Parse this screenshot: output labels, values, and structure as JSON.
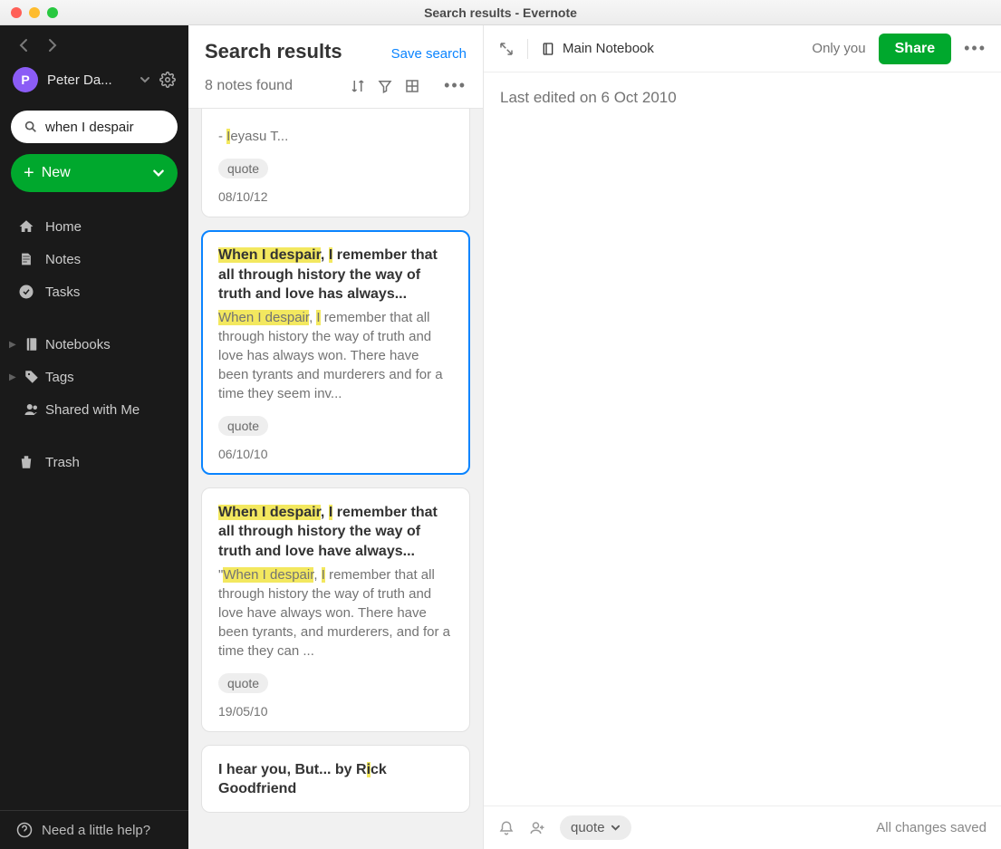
{
  "window": {
    "title": "Search results - Evernote"
  },
  "sidebar": {
    "user": {
      "initial": "P",
      "name": "Peter Da..."
    },
    "search_value": "when I despair",
    "new_label": "New",
    "nav": {
      "home": "Home",
      "notes": "Notes",
      "tasks": "Tasks",
      "notebooks": "Notebooks",
      "tags": "Tags",
      "shared": "Shared with Me",
      "trash": "Trash"
    },
    "help": "Need a little help?"
  },
  "mid": {
    "title": "Search results",
    "save_search": "Save search",
    "count": "8 notes found",
    "cards": [
      {
        "snippet_prefix": "- ",
        "snippet_hl": "I",
        "snippet_rest": "eyasu T...",
        "tag": "quote",
        "date": "08/10/12"
      },
      {
        "selected": true,
        "title_hl1": "When I despair",
        "title_mid1": ", ",
        "title_hl2": "I",
        "title_rest": " remember that all through history the way of truth and love has always...",
        "body_hl1": "When I despair",
        "body_mid1": ", ",
        "body_hl2": "I",
        "body_rest": " remember that all through history the way of truth and love has always won. There have been tyrants and murderers and for a time they seem inv...",
        "tag": "quote",
        "date": "06/10/10"
      },
      {
        "title_hl1": "When I despair",
        "title_mid1": ", ",
        "title_hl2": "I",
        "title_rest": " remember that all through history the way of truth and love have always...",
        "body_pre": "\"",
        "body_hl1": "When I despair",
        "body_mid1": ", ",
        "body_hl2": "I",
        "body_rest": " remember that all through history the way of truth and love have always won. There have been tyrants, and murderers, and for a time they can ...",
        "tag": "quote",
        "date": "19/05/10"
      },
      {
        "title_pre": "I hear you, But... by R",
        "title_hl1": "i",
        "title_rest": "ck Goodfriend"
      }
    ]
  },
  "right": {
    "notebook": "Main Notebook",
    "privacy": "Only you",
    "share": "Share",
    "last_edited": "Last edited on 6 Oct 2010",
    "tag": "quote",
    "saved": "All changes saved"
  }
}
